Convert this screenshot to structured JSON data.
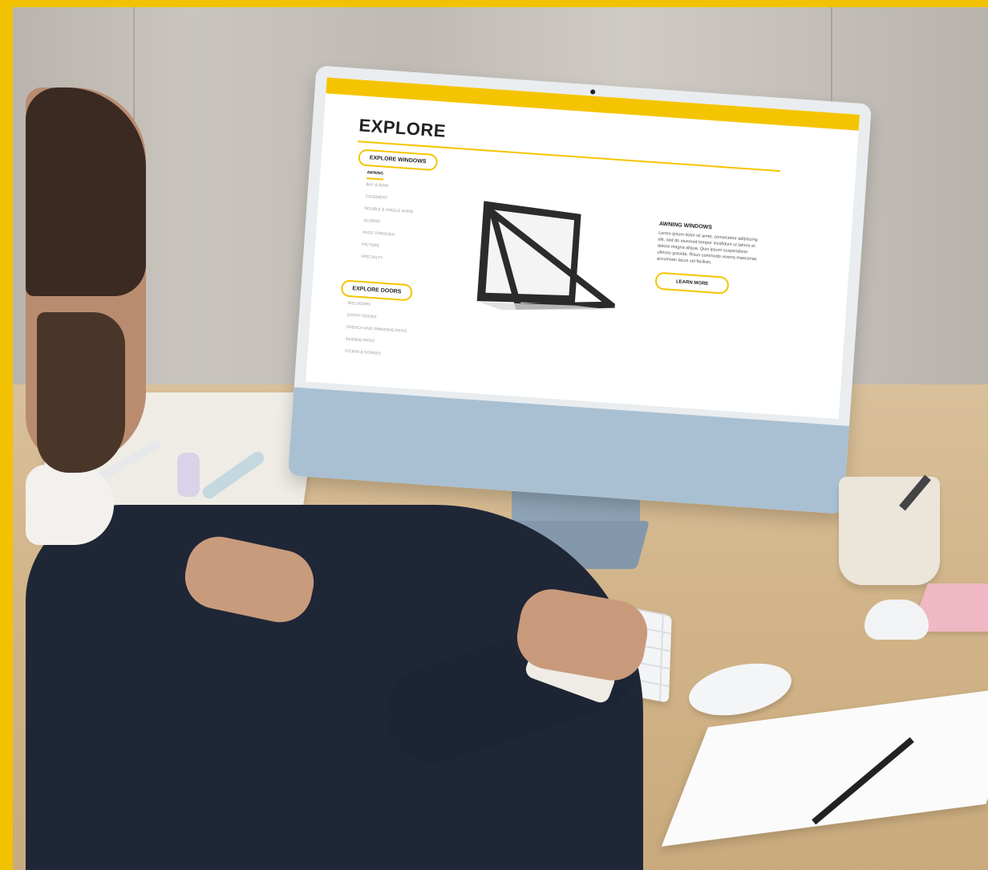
{
  "site": {
    "accent_color": "#f5c400",
    "page_title": "EXPLORE",
    "windows_button": "EXPLORE WINDOWS",
    "windows_menu": [
      "AWNING",
      "BAY & BOW",
      "CASEMENT",
      "DOUBLE & SINGLE HUNG",
      "GLIDING",
      "PASS-THROUGH",
      "PICTURE",
      "SPECIALTY"
    ],
    "doors_button": "EXPLORE DOORS",
    "doors_menu": [
      "BIG DOORS",
      "ENTRY DOORS",
      "FRENCH AND SWINGING PATIO",
      "GLIDING PATIO",
      "STORM & SCREEN"
    ],
    "product": {
      "title": "AWNING WINDOWS",
      "description": "Lorem ipsum dolor sit amet, consectetur adipiscing elit, sed do eiusmod tempor incididunt ut labore et dolore magna aliqua. Quis ipsum suspendisse ultrices gravida. Risus commodo viverra maecenas accumsan lacus vel facilisis.",
      "button": "LEARN MORE"
    }
  }
}
